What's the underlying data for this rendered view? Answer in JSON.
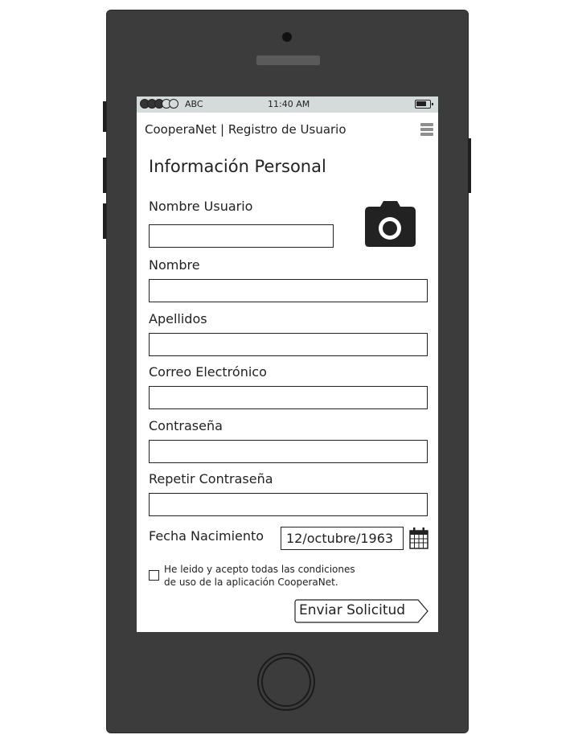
{
  "status_bar": {
    "carrier": "ABC",
    "time": "11:40 AM",
    "signal_bars_filled": 3,
    "signal_bars_total": 5
  },
  "header": {
    "title": "CooperaNet | Registro de Usuario",
    "menu_icon": "hamburger-icon"
  },
  "form": {
    "section_title": "Información Personal",
    "avatar_icon": "camera-icon",
    "fields": {
      "username": {
        "label": "Nombre Usuario",
        "value": ""
      },
      "first_name": {
        "label": "Nombre",
        "value": ""
      },
      "last_name": {
        "label": "Apellidos",
        "value": ""
      },
      "email": {
        "label": "Correo Electrónico",
        "value": ""
      },
      "password": {
        "label": "Contraseña",
        "value": ""
      },
      "password_repeat": {
        "label": "Repetir Contraseña",
        "value": ""
      }
    },
    "birth_date": {
      "label": "Fecha Nacimiento",
      "value": "12/octubre/1963",
      "icon": "calendar-icon"
    },
    "terms": {
      "line1": "He leido y acepto todas las condiciones",
      "line2": "de uso de la aplicación CooperaNet.",
      "checked": false
    },
    "submit_label": "Enviar Solicitud"
  },
  "colors": {
    "phone_body": "#3c3c3c",
    "status_bar_bg": "#d5dadb",
    "menu_icon": "#8e8e8e",
    "ink": "#222222"
  }
}
